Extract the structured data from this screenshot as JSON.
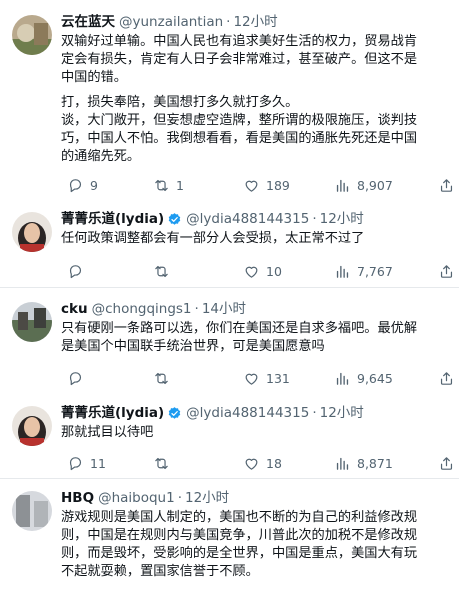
{
  "tweets": [
    {
      "name": "云在蓝天",
      "handle": "@yunzailantian",
      "dot": "·",
      "time": "12小时",
      "verified": false,
      "lines": [
        "双输好过单输。中国人民也有追求美好生活的权力，贸易战肯",
        "定会有损失，肯定有人日子会非常难过，甚至破产。但这不是",
        "中国的错。",
        "打，损失奉陪，美国想打多久就打多久。",
        "谈，大门敞开，但妄想虚空造牌，整所谓的极限施压，谈判技",
        "巧，中国人不怕。我倒想看看，看是美国的通胀先死还是中国",
        "的通缩先死。"
      ],
      "gap_after": [
        2
      ],
      "stats": {
        "replies": "9",
        "retweets": "1",
        "likes": "189",
        "views": "8,907"
      }
    },
    {
      "name": "菁菁乐道(lydia)",
      "handle": "@lydia488144315",
      "dot": "·",
      "time": "12小时",
      "verified": true,
      "lines": [
        "任何政策调整都会有一部分人会受损，太正常不过了"
      ],
      "gap_after": [],
      "stats": {
        "replies": "",
        "retweets": "",
        "likes": "10",
        "views": "7,767"
      }
    },
    {
      "name": "cku",
      "handle": "@chongqings1",
      "dot": "·",
      "time": "14小时",
      "verified": false,
      "lines": [
        "只有硬刚一条路可以选，你们在美国还是自求多福吧。最优解",
        "是美国个中国联手统治世界，可是美国愿意吗"
      ],
      "gap_after": [],
      "stats": {
        "replies": "",
        "retweets": "",
        "likes": "131",
        "views": "9,645"
      }
    },
    {
      "name": "菁菁乐道(lydia)",
      "handle": "@lydia488144315",
      "dot": "·",
      "time": "12小时",
      "verified": true,
      "lines": [
        "那就拭目以待吧"
      ],
      "gap_after": [],
      "stats": {
        "replies": "11",
        "retweets": "",
        "likes": "18",
        "views": "8,871"
      }
    },
    {
      "name": "HBQ",
      "handle": "@haiboqu1",
      "dot": "·",
      "time": "12小时",
      "verified": false,
      "lines": [
        "游戏规则是美国人制定的，美国也不断的为自己的利益修改规",
        "则，中国是在规则内与美国竞争，川普此次的加税不是修改规",
        "则，而是毁坏，受影响的是全世界，中国是重点，美国大有玩",
        "不起就耍赖，置国家信誉于不顾。"
      ],
      "gap_after": [],
      "stats": null
    }
  ],
  "icons": {
    "reply": "reply-icon",
    "retweet": "retweet-icon",
    "like": "heart-icon",
    "views": "views-chart-icon",
    "share": "share-icon",
    "verified": "verified-badge-icon"
  },
  "colors": {
    "text": "#0f1419",
    "secondary": "#536471",
    "verified": "#1d9bf0",
    "divider": "#e6e9ec"
  }
}
